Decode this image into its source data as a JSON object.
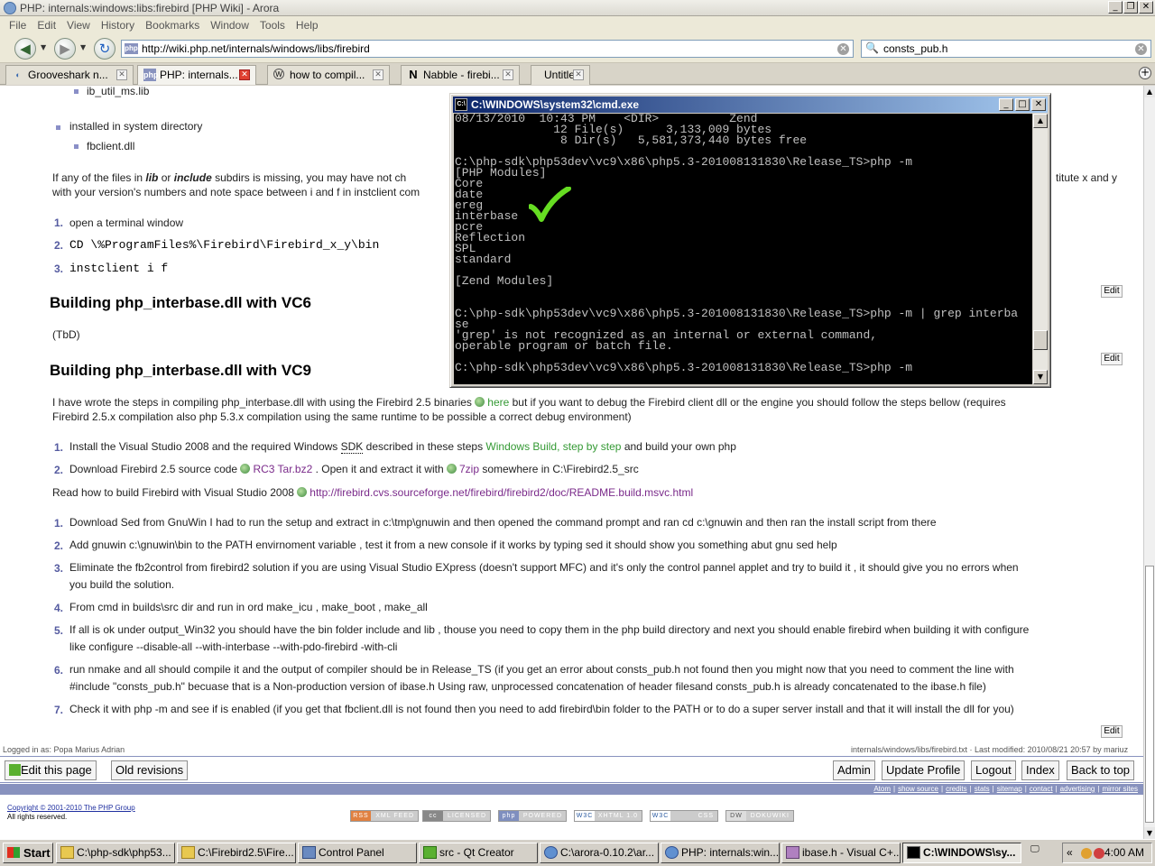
{
  "window": {
    "title": "PHP: internals:windows:libs:firebird [PHP Wiki] - Arora"
  },
  "menubar": [
    "File",
    "Edit",
    "View",
    "History",
    "Bookmarks",
    "Window",
    "Tools",
    "Help"
  ],
  "navbar": {
    "url": "http://wiki.php.net/internals/windows/libs/firebird",
    "favicon_text": "php",
    "search_value": "consts_pub.h"
  },
  "tabs": [
    {
      "label": "Grooveshark n..."
    },
    {
      "label": "PHP: internals..."
    },
    {
      "label": "how to compil..."
    },
    {
      "label": "Nabble - firebi..."
    },
    {
      "label": "Untitled"
    }
  ],
  "page": {
    "list_top": {
      "item1": "ib_util_ms.lib",
      "item2": "installed in system directory",
      "item3": "fbclient.dll"
    },
    "para_missing": {
      "p1": "If any of the files in ",
      "lib": "lib",
      "p2": " or ",
      "include": "include",
      "p3": " subdirs is missing, you may have not ch",
      "tail": "titute x and y",
      "line2": "with your version's numbers and note space between i and f in instclient com"
    },
    "steps1": {
      "n1": "1.",
      "s1": "open a terminal window",
      "n2": "2.",
      "s2": "CD \\%ProgramFiles%\\Firebird\\Firebird_x_y\\bin",
      "n3": "3.",
      "s3": "instclient i f"
    },
    "heading_vc6": "Building php_interbase.dll with VC6",
    "tbd": "(TbD)",
    "heading_vc9": "Building php_interbase.dll with VC9",
    "intro": {
      "a": "I have wrote the steps in compiling php_interbase.dll with using the Firebird 2.5 binaries ",
      "link": "here",
      "b": " but if you want to debug the Firebird client dll or the engine you should follow the steps bellow (requires",
      "line2": "Firebird 2.5.x compilation also php 5.3.x compilation using the same runtime to be possible a correct debug environment)"
    },
    "steps2": {
      "n1": "1.",
      "s1a": "Install the Visual Studio 2008 and the required Windows ",
      "s1sdk": "SDK",
      "s1b": " described in these steps ",
      "s1link": "Windows Build, step by step",
      "s1c": " and build your own php",
      "n2": "2.",
      "s2a": "Download Firebird 2.5 source code ",
      "s2link1": "RC3 Tar.bz2",
      "s2b": " . Open it and extract it with ",
      "s2link2": "7zip",
      "s2c": " somewhere in C:\\Firebird2.5_src"
    },
    "readhow": {
      "a": "Read how to build Firebird with Visual Studio 2008 ",
      "link": "http://firebird.cvs.sourceforge.net/firebird/firebird2/doc/README.build.msvc.html"
    },
    "steps3": [
      {
        "n": "1.",
        "l1": "Download Sed from GnuWin I had to run the setup and extract in c:\\tmp\\gnuwin and then opened the command prompt and ran cd c:\\gnuwin and then ran the install script from there",
        "l2": ""
      },
      {
        "n": "2.",
        "l1": "Add gnuwin c:\\gnuwin\\bin to the PATH envirnoment variable , test it from a new console if it works by typing sed it should show you something abut gnu sed help",
        "l2": ""
      },
      {
        "n": "3.",
        "l1": "Eliminate the fb2control from firebird2 solution if you are using Visual Studio EXpress (doesn't support MFC) and it's only the control pannel applet and try to build it , it should give you no errors when",
        "l2": "you build the solution."
      },
      {
        "n": "4.",
        "l1": "From cmd in builds\\src dir and run in ord make_icu , make_boot , make_all",
        "l2": ""
      },
      {
        "n": "5.",
        "l1": "If all is ok under output_Win32 you should have the bin folder include and lib , thouse you need to copy them in the php build directory and next you should enable firebird when building it with configure",
        "l2": "like configure --disable-all --with-interbase --with-pdo-firebird -with-cli"
      },
      {
        "n": "6.",
        "l1": "run nmake and all should compile it and the output of compiler should be in Release_TS (if you get an error about consts_pub.h not found then you might now that you need to comment the line with",
        "l2": "#include \"consts_pub.h\" becuase that is a Non-production version of ibase.h Using raw, unprocessed concatenation of header filesand consts_pub.h is already concatenated to the ibase.h file)"
      },
      {
        "n": "7.",
        "l1": "Check it with php -m and see if is enabled (if you get that fbclient.dll is not found then you need to add firebird\\bin folder to the PATH or to do a super server install and that it will install the dll for you)",
        "l2": ""
      }
    ],
    "edit_label": "Edit",
    "logged_in": "Logged in as: Popa Marius Adrian",
    "page_info": "internals/windows/libs/firebird.txt · Last modified: 2010/08/21 20:57 by mariuz",
    "bar_buttons": {
      "edit_page": "Edit this page",
      "old_revisions": "Old revisions",
      "admin": "Admin",
      "update_profile": "Update Profile",
      "logout": "Logout",
      "index": "Index",
      "back_to_top": "Back to top"
    },
    "footer_links": [
      "Atom",
      "show source",
      "credits",
      "stats",
      "sitemap",
      "contact",
      "advertising",
      "mirror sites"
    ],
    "copyright": "Copyright © 2001-2010 The PHP Group",
    "rights": "All rights reserved.",
    "badges": [
      {
        "icon": "RSS",
        "text": "XML FEED",
        "color": "#e08040"
      },
      {
        "icon": "cc",
        "text": "LICENSED",
        "color": "#a0a0a0"
      },
      {
        "icon": "php",
        "text": "POWERED",
        "color": "#7f8fbf"
      },
      {
        "icon": "W3C",
        "text": "XHTML 1.0",
        "color": "#a0a0a0"
      },
      {
        "icon": "W3C",
        "text": "CSS",
        "color": "#a0a0a0"
      },
      {
        "icon": "DW",
        "text": "DOKUWIKI",
        "color": "#a0a0a0"
      }
    ]
  },
  "cmd": {
    "title": "C:\\WINDOWS\\system32\\cmd.exe",
    "icon_text": "C:\\",
    "lines": [
      "08/13/2010  10:43 PM    <DIR>          Zend",
      "              12 File(s)      3,133,009 bytes",
      "               8 Dir(s)   5,581,373,440 bytes free",
      "",
      "C:\\php-sdk\\php53dev\\vc9\\x86\\php5.3-201008131830\\Release_TS>php -m",
      "[PHP Modules]",
      "Core",
      "date",
      "ereg",
      "interbase",
      "pcre",
      "Reflection",
      "SPL",
      "standard",
      "",
      "[Zend Modules]",
      "",
      "",
      "C:\\php-sdk\\php53dev\\vc9\\x86\\php5.3-201008131830\\Release_TS>php -m | grep interba",
      "se",
      "'grep' is not recognized as an internal or external command,",
      "operable program or batch file.",
      "",
      "C:\\php-sdk\\php53dev\\vc9\\x86\\php5.3-201008131830\\Release_TS>php -m"
    ]
  },
  "taskbar": {
    "start": "Start",
    "items": [
      {
        "label": "C:\\php-sdk\\php53...",
        "icon": "folder"
      },
      {
        "label": "C:\\Firebird2.5\\Fire...",
        "icon": "folder"
      },
      {
        "label": "Control Panel",
        "icon": "cp"
      },
      {
        "label": "src - Qt Creator",
        "icon": "qt"
      },
      {
        "label": "C:\\arora-0.10.2\\ar...",
        "icon": "arora"
      },
      {
        "label": "PHP: internals:win...",
        "icon": "arora"
      },
      {
        "label": "ibase.h - Visual C+...",
        "icon": "vc"
      },
      {
        "label": "C:\\WINDOWS\\sy...",
        "icon": "cmd"
      }
    ],
    "clock": "4:00 AM",
    "tray_chevron": "«"
  },
  "colors": {
    "link_green": "#339933",
    "link_purple": "#7a2a8a",
    "checkmark": "#66dd22",
    "php_bar": "#8892be"
  }
}
